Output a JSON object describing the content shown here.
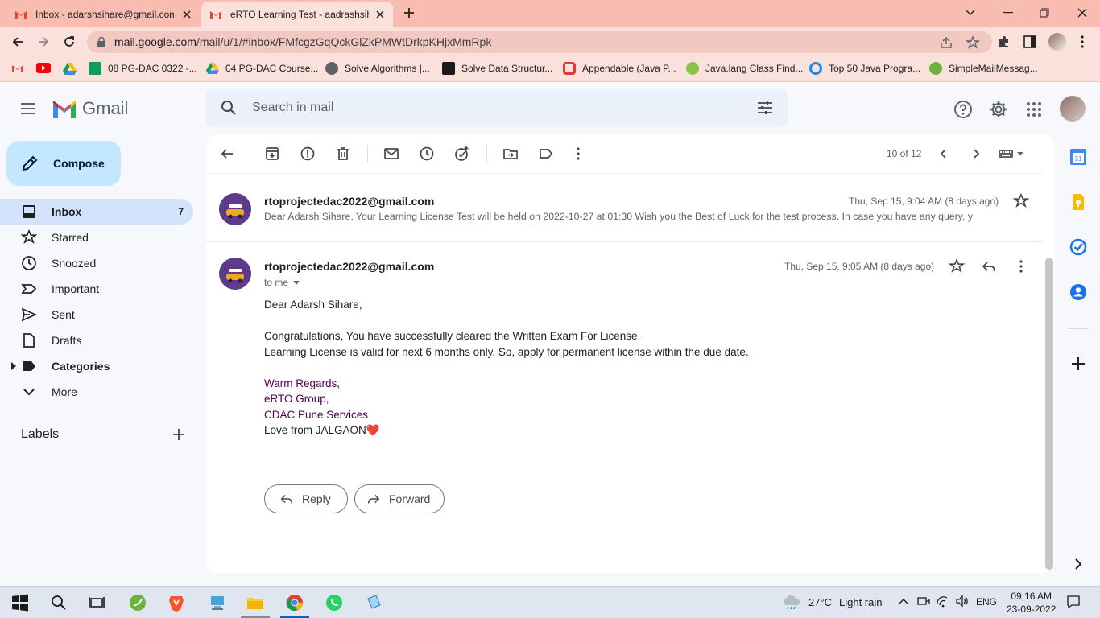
{
  "browser": {
    "tabs": [
      {
        "title": "Inbox - adarshsihare@gmail.com",
        "active": false
      },
      {
        "title": "eRTO Learning Test - aadrashsihare",
        "active": true
      }
    ],
    "url_host": "mail.google.com",
    "url_path": "/mail/u/1/#inbox/FMfcgzGqQckGlZkPMWtDrkpKHjxMmRpk",
    "bookmarks": [
      {
        "label": "08 PG-DAC 0322 -...",
        "icon": "google-sheets-icon"
      },
      {
        "label": "04 PG-DAC Course...",
        "icon": "google-drive-icon"
      },
      {
        "label": "Solve Algorithms |...",
        "icon": "hackerrank-icon"
      },
      {
        "label": "Solve Data Structur...",
        "icon": "hackerrank-icon"
      },
      {
        "label": "Appendable (Java P...",
        "icon": "oracle-icon"
      },
      {
        "label": "Java.lang Class Find...",
        "icon": "java-icon"
      },
      {
        "label": "Top 50 Java Progra...",
        "icon": "site-icon"
      },
      {
        "label": "SimpleMailMessag...",
        "icon": "spring-icon"
      }
    ]
  },
  "gmail": {
    "brand": "Gmail",
    "search_placeholder": "Search in mail",
    "compose_label": "Compose",
    "nav": [
      {
        "label": "Inbox",
        "count": "7",
        "icon": "inbox-icon",
        "active": true
      },
      {
        "label": "Starred",
        "count": "",
        "icon": "star-icon"
      },
      {
        "label": "Snoozed",
        "count": "",
        "icon": "clock-icon"
      },
      {
        "label": "Important",
        "count": "",
        "icon": "important-icon"
      },
      {
        "label": "Sent",
        "count": "",
        "icon": "send-icon"
      },
      {
        "label": "Drafts",
        "count": "",
        "icon": "draft-icon"
      },
      {
        "label": "Categories",
        "count": "",
        "icon": "label-icon",
        "bold": true
      },
      {
        "label": "More",
        "count": "",
        "icon": "chevron-down-icon"
      }
    ],
    "labels_heading": "Labels"
  },
  "toolbar": {
    "pager": "10 of 12"
  },
  "thread": {
    "collapsed": {
      "sender": "rtoprojectedac2022@gmail.com",
      "date": "Thu, Sep 15, 9:04 AM (8 days ago)",
      "snippet": "Dear Adarsh Sihare, Your Learning License Test will be held on 2022-10-27 at 01:30 Wish you the Best of Luck for the test process. In case you have any query, y"
    },
    "expanded": {
      "sender": "rtoprojectedac2022@gmail.com",
      "date": "Thu, Sep 15, 9:05 AM (8 days ago)",
      "to": "to me",
      "greeting": "Dear Adarsh Sihare,",
      "line1": "Congratulations, You have successfully cleared the Written Exam For License.",
      "line2": "Learning License is valid for next 6 months only. So, apply for permanent license within the due date.",
      "sig1": "Warm Regards,",
      "sig2": "eRTO Group,",
      "sig3": "CDAC Pune Services",
      "sig4": "Love from JALGAON",
      "heart": "❤️"
    },
    "reply_label": "Reply",
    "forward_label": "Forward"
  },
  "taskbar": {
    "weather_temp": "27°C",
    "weather_desc": "Light rain",
    "lang": "ENG",
    "time": "09:16 AM",
    "date": "23-09-2022"
  },
  "colors": {
    "tabbar": "#f8bcb1",
    "compose_bg": "#c2e7ff",
    "inbox_active": "#d3e3fd",
    "signature": "#500050"
  }
}
